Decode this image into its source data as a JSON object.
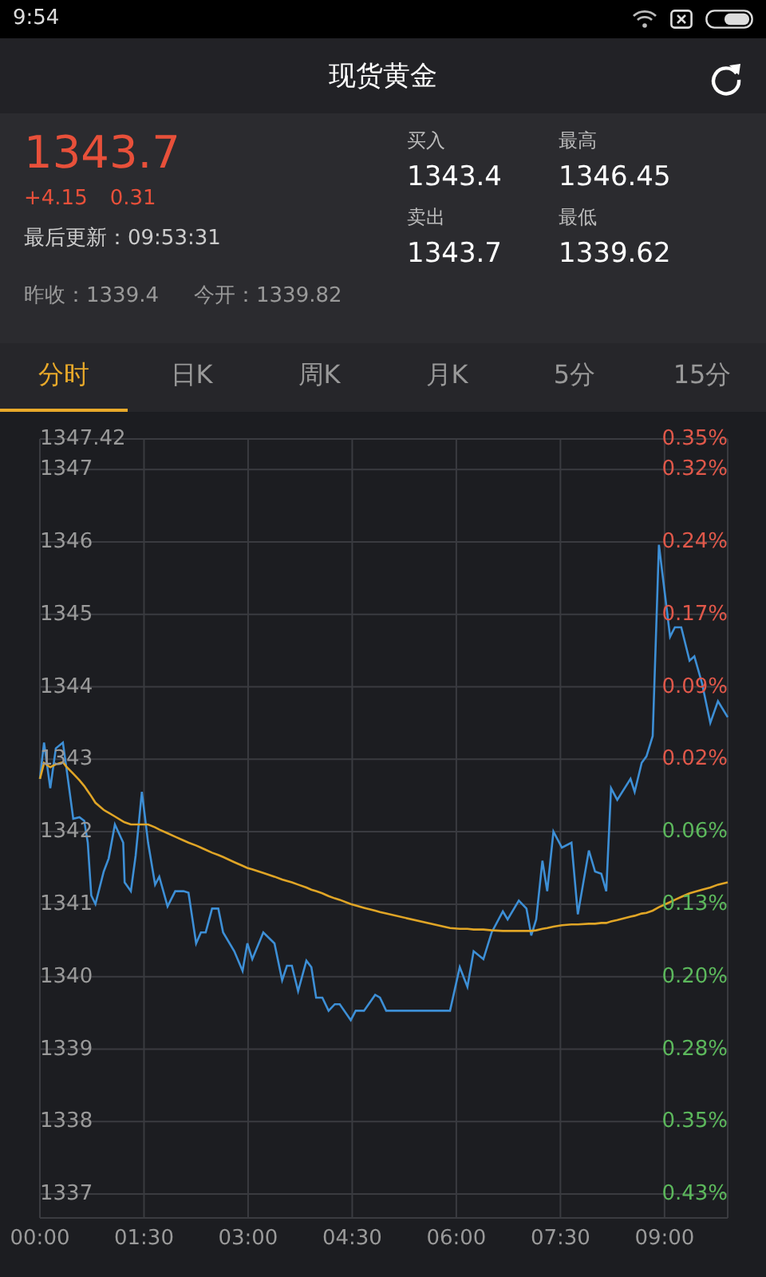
{
  "status_bar": {
    "time": "9:54"
  },
  "header": {
    "title": "现货黄金"
  },
  "quote": {
    "price": "1343.7",
    "change": "+4.15",
    "change_percent": "0.31",
    "updated": "最后更新：09:53:31",
    "prev_close": "昨收：1339.4",
    "open": "今开：1339.82",
    "stats": [
      {
        "label": "买入",
        "value": "1343.4"
      },
      {
        "label": "最高",
        "value": "1346.45"
      },
      {
        "label": "卖出",
        "value": "1343.7"
      },
      {
        "label": "最低",
        "value": "1339.62"
      }
    ]
  },
  "tabs": [
    {
      "label": "分时",
      "selected": true
    },
    {
      "label": "日K",
      "selected": false
    },
    {
      "label": "周K",
      "selected": false
    },
    {
      "label": "月K",
      "selected": false
    },
    {
      "label": "5分",
      "selected": false
    },
    {
      "label": "15分",
      "selected": false
    }
  ],
  "chart": {
    "chart_data": {
      "type": "line",
      "x": [
        0,
        0.06,
        0.15,
        0.23,
        0.33,
        0.38,
        0.48,
        0.57,
        0.64,
        0.69,
        0.74,
        0.8,
        0.92,
        0.99,
        1.08,
        1.2,
        1.22,
        1.31,
        1.38,
        1.47,
        1.56,
        1.66,
        1.72,
        1.84,
        1.95,
        2.07,
        2.14,
        2.25,
        2.32,
        2.39,
        2.48,
        2.57,
        2.64,
        2.8,
        2.92,
        2.99,
        3.06,
        3.22,
        3.38,
        3.49,
        3.56,
        3.63,
        3.72,
        3.84,
        3.91,
        3.98,
        4.07,
        4.16,
        4.25,
        4.32,
        4.48,
        4.55,
        4.67,
        4.83,
        4.9,
        4.99,
        5.91,
        6.05,
        6.16,
        6.25,
        6.39,
        6.51,
        6.67,
        6.74,
        6.9,
        7.01,
        7.08,
        7.15,
        7.24,
        7.31,
        7.4,
        7.52,
        7.66,
        7.75,
        7.91,
        8.0,
        8.09,
        8.16,
        8.23,
        8.32,
        8.51,
        8.57,
        8.67,
        8.74,
        8.83,
        8.92,
        9.08,
        9.15,
        9.24,
        9.36,
        9.43,
        9.54,
        9.66,
        9.77,
        9.91
      ],
      "grid": true,
      "series": [
        {
          "color": "#3d8fd6",
          "values": [
            1342.73,
            1343.23,
            1342.6,
            1343.15,
            1343.23,
            1342.9,
            1342.18,
            1342.2,
            1342.15,
            1341.85,
            1341.12,
            1341.0,
            1341.45,
            1341.63,
            1342.1,
            1341.85,
            1341.3,
            1341.18,
            1341.67,
            1342.55,
            1341.85,
            1341.27,
            1341.38,
            1340.97,
            1341.18,
            1341.18,
            1341.16,
            1340.46,
            1340.61,
            1340.61,
            1340.94,
            1340.94,
            1340.61,
            1340.35,
            1340.08,
            1340.46,
            1340.24,
            1340.61,
            1340.46,
            1339.95,
            1340.15,
            1340.15,
            1339.8,
            1340.22,
            1340.13,
            1339.71,
            1339.71,
            1339.53,
            1339.62,
            1339.62,
            1339.4,
            1339.53,
            1339.53,
            1339.75,
            1339.71,
            1339.53,
            1339.53,
            1340.13,
            1339.86,
            1340.35,
            1340.24,
            1340.61,
            1340.9,
            1340.79,
            1341.05,
            1340.94,
            1340.57,
            1340.79,
            1341.6,
            1341.18,
            1342.0,
            1341.78,
            1341.85,
            1340.86,
            1341.74,
            1341.45,
            1341.42,
            1341.18,
            1342.6,
            1342.44,
            1342.73,
            1342.55,
            1342.95,
            1343.04,
            1343.32,
            1345.96,
            1344.69,
            1344.82,
            1344.82,
            1344.36,
            1344.42,
            1344.05,
            1343.5,
            1343.8,
            1343.58
          ]
        },
        {
          "color": "#e0a526",
          "values": [
            1342.73,
            1342.95,
            1342.89,
            1342.93,
            1342.96,
            1342.9,
            1342.8,
            1342.71,
            1342.63,
            1342.56,
            1342.49,
            1342.4,
            1342.3,
            1342.26,
            1342.21,
            1342.14,
            1342.13,
            1342.1,
            1342.1,
            1342.1,
            1342.1,
            1342.06,
            1342.03,
            1341.98,
            1341.93,
            1341.88,
            1341.85,
            1341.81,
            1341.78,
            1341.75,
            1341.71,
            1341.68,
            1341.65,
            1341.58,
            1341.53,
            1341.5,
            1341.48,
            1341.43,
            1341.38,
            1341.34,
            1341.32,
            1341.3,
            1341.27,
            1341.23,
            1341.2,
            1341.18,
            1341.15,
            1341.11,
            1341.08,
            1341.06,
            1341.0,
            1340.98,
            1340.95,
            1340.91,
            1340.89,
            1340.87,
            1340.67,
            1340.66,
            1340.66,
            1340.65,
            1340.65,
            1340.64,
            1340.63,
            1340.63,
            1340.63,
            1340.63,
            1340.63,
            1340.64,
            1340.66,
            1340.67,
            1340.69,
            1340.71,
            1340.72,
            1340.72,
            1340.73,
            1340.73,
            1340.74,
            1340.74,
            1340.76,
            1340.78,
            1340.83,
            1340.84,
            1340.87,
            1340.88,
            1340.91,
            1340.96,
            1341.03,
            1341.06,
            1341.1,
            1341.15,
            1341.17,
            1341.2,
            1341.23,
            1341.27,
            1341.3
          ]
        }
      ],
      "xlim": [
        0,
        9.91
      ],
      "ylim": [
        1336.67,
        1347.42
      ],
      "xticks": [
        {
          "value": 0,
          "label": "00:00"
        },
        {
          "value": 1.5,
          "label": "01:30"
        },
        {
          "value": 3,
          "label": "03:00"
        },
        {
          "value": 4.5,
          "label": "04:30"
        },
        {
          "value": 6,
          "label": "06:00"
        },
        {
          "value": 7.5,
          "label": "07:30"
        },
        {
          "value": 9,
          "label": "09:00"
        }
      ],
      "yticks": [
        {
          "value": 1347.42,
          "label": "1347.42"
        },
        {
          "value": 1347,
          "label": "1347"
        },
        {
          "value": 1346,
          "label": "1346"
        },
        {
          "value": 1345,
          "label": "1345"
        },
        {
          "value": 1344,
          "label": "1344"
        },
        {
          "value": 1343,
          "label": "1343"
        },
        {
          "value": 1342,
          "label": "1342"
        },
        {
          "value": 1341,
          "label": "1341"
        },
        {
          "value": 1340,
          "label": "1340"
        },
        {
          "value": 1339,
          "label": "1339"
        },
        {
          "value": 1338,
          "label": "1338"
        },
        {
          "value": 1337,
          "label": "1337"
        }
      ]
    },
    "right_ticks": [
      {
        "label": "0.35%",
        "kind": "up"
      },
      {
        "label": "0.32%",
        "kind": "up"
      },
      {
        "label": "0.24%",
        "kind": "up"
      },
      {
        "label": "0.17%",
        "kind": "up"
      },
      {
        "label": "0.09%",
        "kind": "up"
      },
      {
        "label": "0.02%",
        "kind": "up"
      },
      {
        "label": "0.06%",
        "kind": "down"
      },
      {
        "label": "0.13%",
        "kind": "down"
      },
      {
        "label": "0.20%",
        "kind": "down"
      },
      {
        "label": "0.28%",
        "kind": "down"
      },
      {
        "label": "0.35%",
        "kind": "down"
      },
      {
        "label": "0.43%",
        "kind": "down"
      }
    ]
  }
}
